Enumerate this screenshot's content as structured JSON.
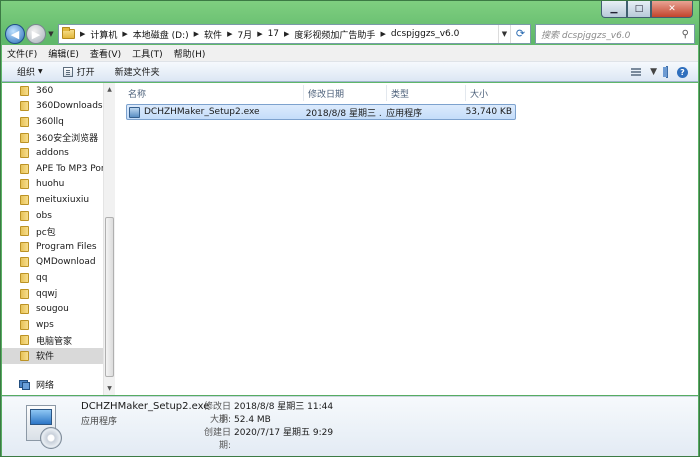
{
  "address": {
    "crumbs": [
      "计算机",
      "本地磁盘 (D:)",
      "软件",
      "7月",
      "17",
      "度彩视频加广告助手",
      "dcspjggzs_v6.0"
    ],
    "search_placeholder": "搜索 dcspjggzs_v6.0"
  },
  "menubar": {
    "items": [
      "文件(F)",
      "编辑(E)",
      "查看(V)",
      "工具(T)",
      "帮助(H)"
    ]
  },
  "toolbar": {
    "organize": "组织",
    "open": "打开",
    "new_folder": "新建文件夹"
  },
  "navpane": {
    "folders": [
      "360",
      "360Downloads",
      "360llq",
      "360安全浏览器",
      "addons",
      "APE To MP3 Por",
      "huohu",
      "meituxiuxiu",
      "obs",
      "pc包",
      "Program Files",
      "QMDownload",
      "qq",
      "qqwj",
      "sougou",
      "wps",
      "电脑管家",
      "软件"
    ],
    "selected_index": 17,
    "network": "网络"
  },
  "columns": {
    "name": "名称",
    "modified": "修改日期",
    "type": "类型",
    "size": "大小"
  },
  "file": {
    "name": "DCHZHMaker_Setup2.exe",
    "modified": "2018/8/8 星期三 ...",
    "type": "应用程序",
    "size": "53,740 KB"
  },
  "details": {
    "name": "DCHZHMaker_Setup2.exe",
    "type": "应用程序",
    "modified_label": "修改日期:",
    "modified_value": "2018/8/8 星期三 11:44",
    "size_label": "大小:",
    "size_value": "52.4 MB",
    "created_label": "创建日期:",
    "created_value": "2020/7/17 星期五 9:29"
  }
}
